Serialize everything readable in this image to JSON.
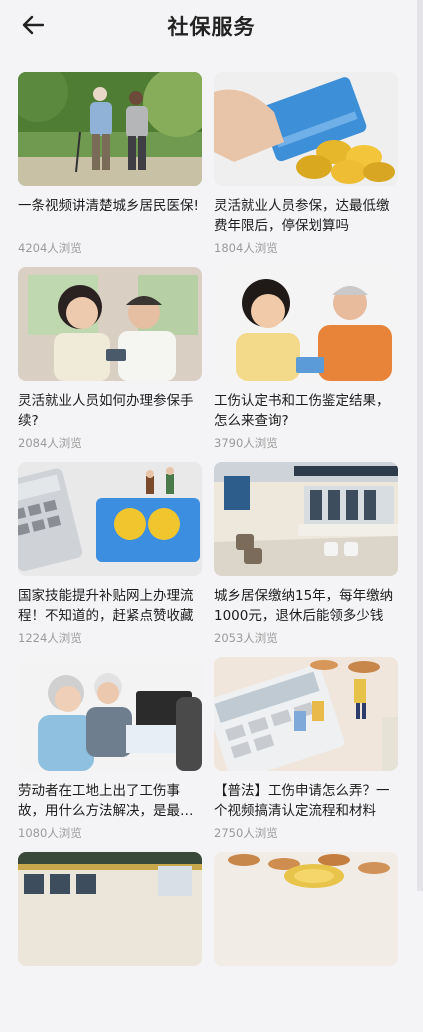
{
  "header": {
    "title": "社保服务",
    "back_icon": "arrow-left-icon"
  },
  "articles": [
    {
      "title": "一条视频讲清楚城乡居民医保!",
      "views": "4204人浏览",
      "image": "elderly-couple-walking"
    },
    {
      "title": "灵活就业人员参保，达最低缴费年限后，停保划算吗",
      "views": "1804人浏览",
      "image": "social-security-card-coins"
    },
    {
      "title": "灵活就业人员如何办理参保手续?",
      "views": "2084人浏览",
      "image": "couple-with-card"
    },
    {
      "title": "工伤认定书和工伤鉴定结果，怎么来查询?",
      "views": "3790人浏览",
      "image": "couple-with-card-2"
    },
    {
      "title": "国家技能提升补贴网上办理流程！不知道的，赶紧点赞收藏",
      "views": "1224人浏览",
      "image": "calculator-card"
    },
    {
      "title": "城乡居保缴纳15年，每年缴纳1000元，退休后能领多少钱",
      "views": "2053人浏览",
      "image": "service-hall"
    },
    {
      "title": "劳动者在工地上出了工伤事故，用什么方法解决，是最有效的",
      "views": "1080人浏览",
      "image": "elderly-consult"
    },
    {
      "title": "【普法】工伤申请怎么弄？一个视频搞清认定流程和材料",
      "views": "2750人浏览",
      "image": "calculator-figures"
    },
    {
      "title": "",
      "views": "",
      "image": "service-hall-2"
    },
    {
      "title": "",
      "views": "",
      "image": "coins-card"
    }
  ]
}
